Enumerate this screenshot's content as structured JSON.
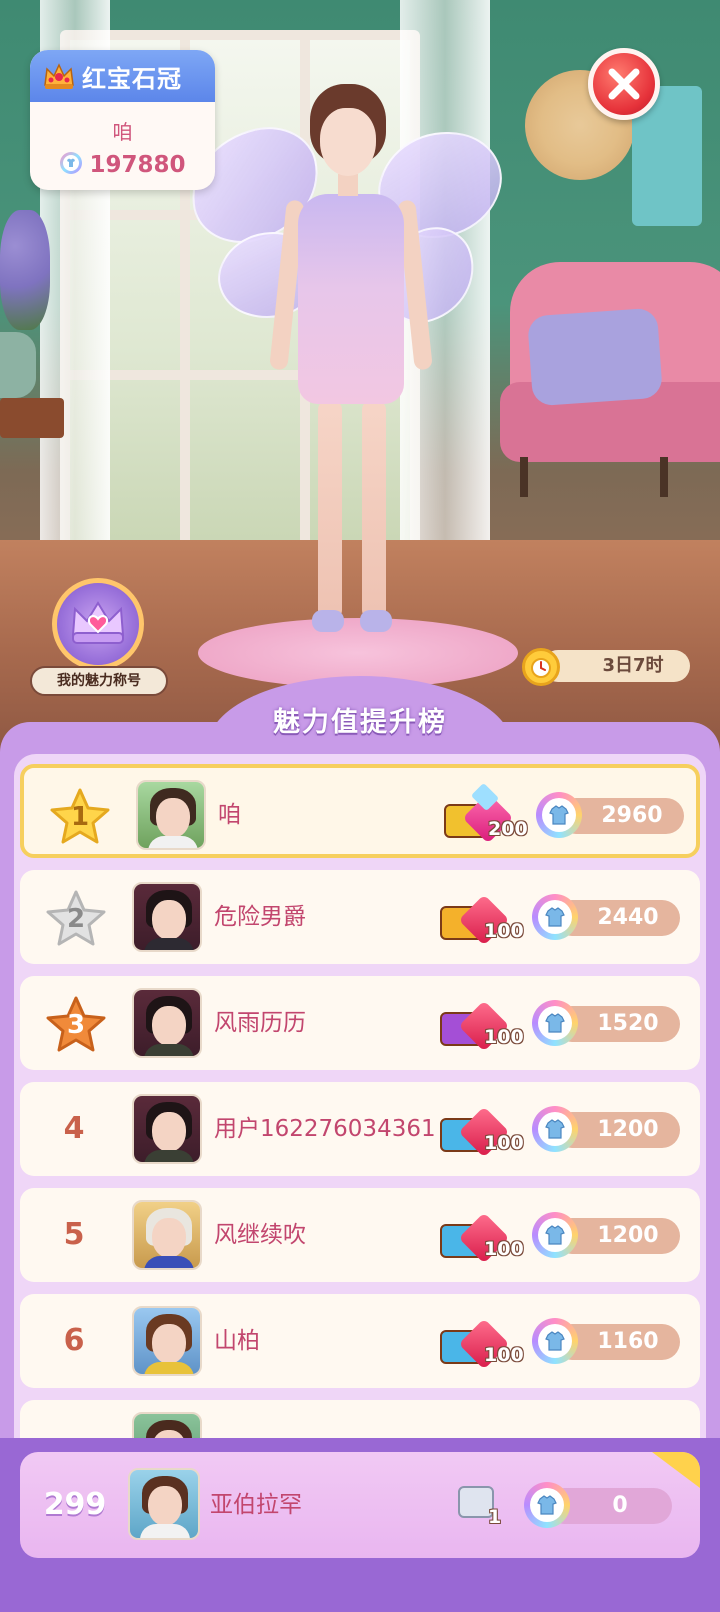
{
  "header": {
    "title_card": {
      "title": "红宝石冠",
      "player_name": "咱",
      "charm_value": "197880"
    },
    "close": {
      "icon": "close-icon"
    }
  },
  "charm_title": {
    "label": "我的魅力称号",
    "icon": "crown-badge-icon"
  },
  "timer": {
    "remaining": "3日7时",
    "icon": "alarm-clock-icon"
  },
  "leaderboard": {
    "title": "魅力值提升榜",
    "rows": [
      {
        "rank": "1",
        "name": "咱",
        "gift_count": "200",
        "score": "2960"
      },
      {
        "rank": "2",
        "name": "危险男爵",
        "gift_count": "100",
        "score": "2440"
      },
      {
        "rank": "3",
        "name": "风雨历历",
        "gift_count": "100",
        "score": "1520"
      },
      {
        "rank": "4",
        "name": "用户162276034361",
        "gift_count": "100",
        "score": "1200"
      },
      {
        "rank": "5",
        "name": "风继续吹",
        "gift_count": "100",
        "score": "1200"
      },
      {
        "rank": "6",
        "name": "山柏",
        "gift_count": "100",
        "score": "1160"
      }
    ]
  },
  "my_rank": {
    "rank": "299",
    "name": "亚伯拉罕",
    "gift_count": "1",
    "score": "0"
  },
  "colors": {
    "panel": "#c89be8",
    "name_pink": "#c2466e",
    "gold_border": "#f6cf5e",
    "rank_gold": "#ffd54a",
    "rank_silver": "#e2e2e2",
    "rank_bronze": "#f08a3a"
  }
}
